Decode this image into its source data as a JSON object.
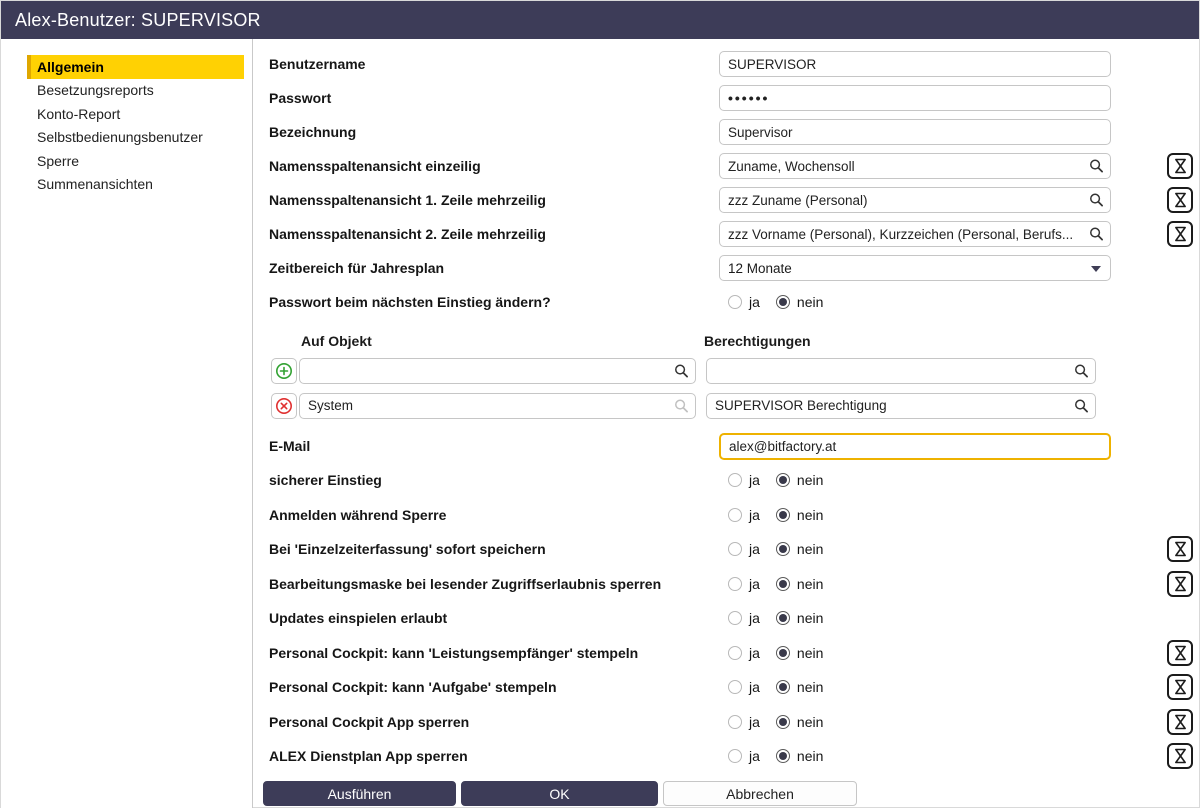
{
  "header": {
    "title": "Alex-Benutzer: SUPERVISOR"
  },
  "sidebar": {
    "items": [
      {
        "label": "Allgemein",
        "active": true
      },
      {
        "label": "Besetzungsreports",
        "active": false
      },
      {
        "label": "Konto-Report",
        "active": false
      },
      {
        "label": "Selbstbedienungsbenutzer",
        "active": false
      },
      {
        "label": "Sperre",
        "active": false
      },
      {
        "label": "Summenansichten",
        "active": false
      }
    ]
  },
  "fields": {
    "benutzername": {
      "label": "Benutzername",
      "value": "SUPERVISOR"
    },
    "passwort": {
      "label": "Passwort",
      "value": "••••••"
    },
    "bezeichnung": {
      "label": "Bezeichnung",
      "value": "Supervisor"
    },
    "namensspalte_einzeilig": {
      "label": "Namensspaltenansicht einzeilig",
      "value": "Zuname, Wochensoll"
    },
    "namensspalte_mehrzeilig_1": {
      "label": "Namensspaltenansicht 1. Zeile mehrzeilig",
      "value": "zzz Zuname (Personal)"
    },
    "namensspalte_mehrzeilig_2": {
      "label": "Namensspaltenansicht 2. Zeile mehrzeilig",
      "value": "zzz Vorname (Personal), Kurzzeichen (Personal, Berufs..."
    },
    "zeitbereich_jahresplan": {
      "label": "Zeitbereich für Jahresplan",
      "value": "12 Monate"
    },
    "passwort_aendern": {
      "label": "Passwort beim nächsten Einstieg ändern?",
      "selected": "nein"
    },
    "email": {
      "label": "E-Mail",
      "value": "alex@bitfactory.at"
    }
  },
  "radio_labels": {
    "ja": "ja",
    "nein": "nein"
  },
  "permissions": {
    "columns": {
      "objekt": "Auf Objekt",
      "berechtigung": "Berechtigungen"
    },
    "new_row": {
      "objekt": "",
      "berechtigung": ""
    },
    "rows": [
      {
        "objekt": "System",
        "berechtigung": "SUPERVISOR Berechtigung"
      }
    ]
  },
  "toggles": [
    {
      "label": "sicherer Einstieg",
      "selected": "nein"
    },
    {
      "label": "Anmelden während Sperre",
      "selected": "nein"
    },
    {
      "label": "Bei 'Einzelzeiterfassung' sofort speichern",
      "selected": "nein"
    },
    {
      "label": "Bearbeitungsmaske bei lesender Zugriffserlaubnis sperren",
      "selected": "nein"
    },
    {
      "label": "Updates einspielen erlaubt",
      "selected": "nein"
    },
    {
      "label": "Personal Cockpit: kann 'Leistungsempfänger' stempeln",
      "selected": "nein"
    },
    {
      "label": "Personal Cockpit: kann 'Aufgabe' stempeln",
      "selected": "nein"
    },
    {
      "label": "Personal Cockpit App sperren",
      "selected": "nein"
    },
    {
      "label": "ALEX Dienstplan App sperren",
      "selected": "nein"
    }
  ],
  "footer": {
    "ausfuehren": "Ausführen",
    "ok": "OK",
    "abbrechen": "Abbrechen"
  },
  "colors": {
    "header_bg": "#3d3c58",
    "active_nav_bg": "#ffd103",
    "email_focus_border": "#eeb200",
    "add_icon": "#32a232",
    "delete_icon": "#e03131"
  }
}
